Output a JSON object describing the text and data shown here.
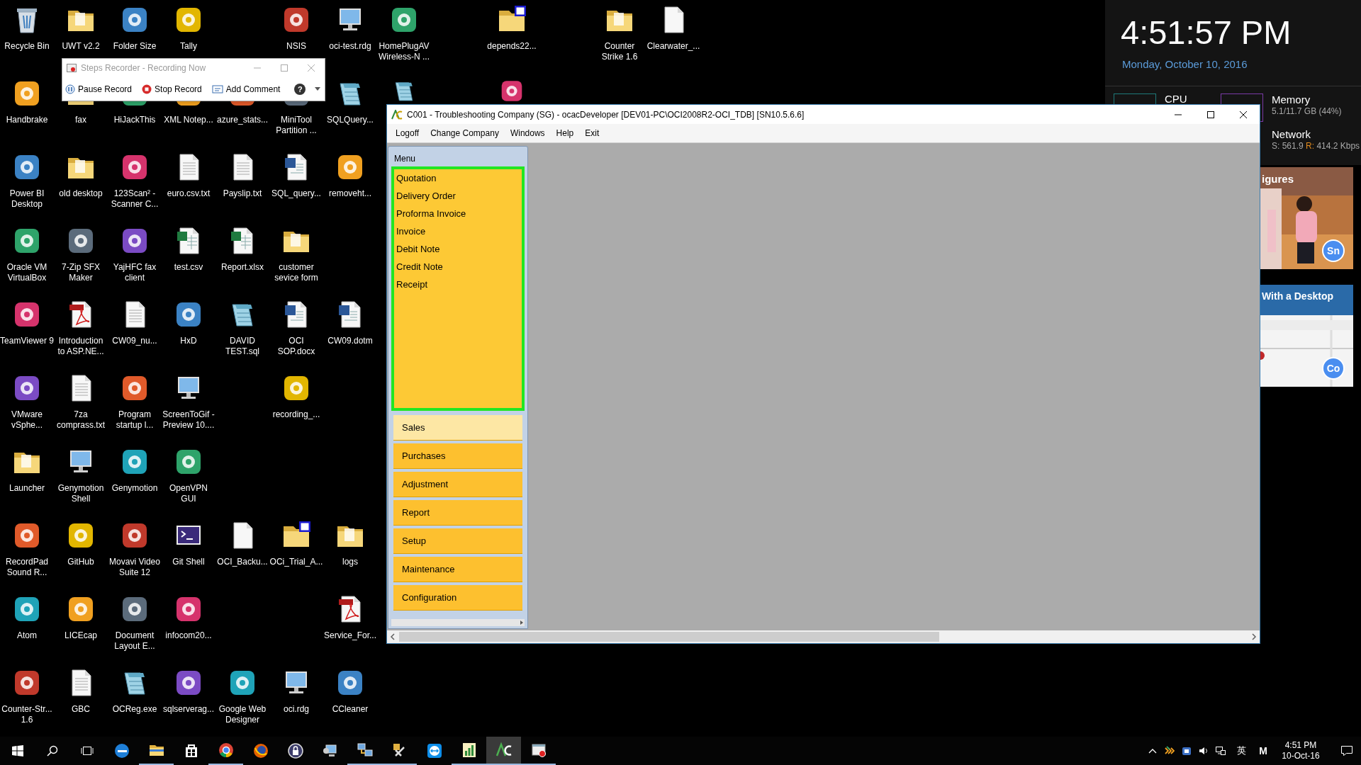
{
  "desktop": {
    "columns": [
      [
        {
          "kind": "recycle",
          "label": "Recycle Bin"
        },
        {
          "kind": "app",
          "label": "Handbrake"
        },
        {
          "kind": "app",
          "label": "Power BI Desktop"
        },
        {
          "kind": "app",
          "label": "Oracle VM VirtualBox"
        },
        {
          "kind": "app",
          "label": "TeamViewer 9"
        },
        {
          "kind": "app",
          "label": "VMware vSphe..."
        },
        {
          "kind": "folder",
          "label": "Launcher"
        },
        {
          "kind": "app",
          "label": "RecordPad Sound R..."
        },
        {
          "kind": "app",
          "label": "Atom"
        },
        {
          "kind": "app",
          "label": "Counter-Str... 1.6"
        }
      ],
      [
        {
          "kind": "folder",
          "label": "UWT v2.2"
        },
        {
          "kind": "folder",
          "label": "fax"
        },
        {
          "kind": "folder",
          "label": "old desktop"
        },
        {
          "kind": "app",
          "label": "7-Zip SFX Maker"
        },
        {
          "kind": "pdf",
          "label": "Introduction to ASP.NE..."
        },
        {
          "kind": "file",
          "label": "7za comprass.txt"
        },
        {
          "kind": "monitor",
          "label": "Genymotion Shell"
        },
        {
          "kind": "app",
          "label": "GitHub"
        },
        {
          "kind": "app",
          "label": "LICEcap"
        },
        {
          "kind": "file",
          "label": "GBC"
        }
      ],
      [
        {
          "kind": "app",
          "label": "Folder Size"
        },
        {
          "kind": "app",
          "label": "HiJackThis"
        },
        {
          "kind": "app",
          "label": "123Scan² - Scanner C..."
        },
        {
          "kind": "app",
          "label": "YajHFC fax client"
        },
        {
          "kind": "file",
          "label": "CW09_nu..."
        },
        {
          "kind": "app",
          "label": "Program startup l..."
        },
        {
          "kind": "app",
          "label": "Genymotion"
        },
        {
          "kind": "app",
          "label": "Movavi Video Suite 12"
        },
        {
          "kind": "app",
          "label": "Document Layout E..."
        },
        {
          "kind": "notepad",
          "label": "OCReg.exe"
        }
      ],
      [
        {
          "kind": "app",
          "label": "Tally"
        },
        {
          "kind": "app",
          "label": "XML Notep..."
        },
        {
          "kind": "file",
          "label": "euro.csv.txt"
        },
        {
          "kind": "excel",
          "label": "test.csv"
        },
        {
          "kind": "app",
          "label": "HxD"
        },
        {
          "kind": "monitor",
          "label": "ScreenToGif - Preview 10...."
        },
        {
          "kind": "app",
          "label": "OpenVPN GUI"
        },
        {
          "kind": "terminal",
          "label": "Git Shell"
        },
        {
          "kind": "app",
          "label": "infocom20..."
        },
        {
          "kind": "app",
          "label": "sqlserverag..."
        }
      ],
      [
        {
          "kind": "blank"
        },
        {
          "kind": "app",
          "label": "azure_stats..."
        },
        {
          "kind": "file",
          "label": "Payslip.txt"
        },
        {
          "kind": "excel",
          "label": "Report.xlsx"
        },
        {
          "kind": "notepad",
          "label": "DAVID TEST.sql"
        },
        {
          "kind": "blank"
        },
        {
          "kind": "blank"
        },
        {
          "kind": "blankfile",
          "label": "OCI_Backu..."
        },
        {
          "kind": "blank"
        },
        {
          "kind": "app",
          "label": "Google Web Designer"
        }
      ],
      [
        {
          "kind": "app",
          "label": "NSIS"
        },
        {
          "kind": "app",
          "label": "MiniTool Partition ..."
        },
        {
          "kind": "word",
          "label": "SQL_query..."
        },
        {
          "kind": "folder",
          "label": "customer sevice form"
        },
        {
          "kind": "word",
          "label": "OCI SOP.docx"
        },
        {
          "kind": "app",
          "label": "recording_..."
        },
        {
          "kind": "blank"
        },
        {
          "kind": "zipfolder",
          "label": "OCi_Trial_A..."
        },
        {
          "kind": "blank"
        },
        {
          "kind": "monitor",
          "label": "oci.rdg"
        }
      ],
      [
        {
          "kind": "monitor",
          "label": "oci-test.rdg"
        },
        {
          "kind": "notepad",
          "label": "SQLQuery..."
        },
        {
          "kind": "app",
          "label": "removeht..."
        },
        {
          "kind": "blank"
        },
        {
          "kind": "word",
          "label": "CW09.dotm"
        },
        {
          "kind": "blank"
        },
        {
          "kind": "blank"
        },
        {
          "kind": "folder",
          "label": "logs"
        },
        {
          "kind": "pdf",
          "label": "Service_For..."
        },
        {
          "kind": "app",
          "label": "CCleaner"
        }
      ],
      [
        {
          "kind": "app",
          "label": "HomePlugAV Wireless-N ..."
        },
        {
          "kind": "notepad"
        }
      ],
      [
        {
          "kind": "blank"
        }
      ],
      [
        {
          "kind": "zipfolder",
          "label": "depends22..."
        },
        {
          "kind": "app"
        }
      ],
      [
        {
          "kind": "blank"
        }
      ],
      [
        {
          "kind": "folder",
          "label": "Counter Strike 1.6"
        }
      ],
      [
        {
          "kind": "blankfile",
          "label": "Clearwater_..."
        }
      ]
    ]
  },
  "steps_recorder": {
    "title": "Steps Recorder - Recording Now",
    "active": false,
    "buttons": [
      {
        "kind": "pause",
        "label": "Pause Record"
      },
      {
        "kind": "stop",
        "label": "Stop Record"
      },
      {
        "kind": "comment",
        "label": "Add Comment"
      }
    ],
    "help": "?"
  },
  "app_window": {
    "title": "C001 - Troubleshooting Company (SG) - ocacDeveloper [DEV01-PC\\OCI2008R2-OCI_TDB] [SN10.5.6.6]",
    "active": true,
    "menu": [
      "Logoff",
      "Change Company",
      "Windows",
      "Help",
      "Exit"
    ],
    "panel": {
      "header": "Menu",
      "items": [
        "Quotation",
        "Delivery Order",
        "Proforma Invoice",
        "Invoice",
        "Debit Note",
        "Credit Note",
        "Receipt"
      ],
      "sections": [
        {
          "label": "Sales",
          "selected": true
        },
        {
          "label": "Purchases",
          "selected": false
        },
        {
          "label": "Adjustment",
          "selected": false
        },
        {
          "label": "Report",
          "selected": false
        },
        {
          "label": "Setup",
          "selected": false
        },
        {
          "label": "Maintenance",
          "selected": false
        },
        {
          "label": "Configuration",
          "selected": false
        }
      ]
    }
  },
  "widget": {
    "time": "4:51:57 PM",
    "date": "Monday, October 10, 2016",
    "cpu": {
      "label": "CPU"
    },
    "memory": {
      "label": "Memory",
      "reading": "5.1/11.7 GB (44%)"
    },
    "network": {
      "label": "Network",
      "sent": "S: 561.9",
      "received_label": "R:",
      "received": "414.2 Kbps"
    }
  },
  "news": [
    {
      "title": "igures",
      "badge": "Sn"
    },
    {
      "title": "With a Desktop",
      "badge": "Co"
    }
  ],
  "taskbar": {
    "apps": [
      {
        "kind": "edge",
        "running": false,
        "selected": false
      },
      {
        "kind": "explorer",
        "running": true,
        "selected": false
      },
      {
        "kind": "store",
        "running": false,
        "selected": false
      },
      {
        "kind": "chrome",
        "running": true,
        "selected": false
      },
      {
        "kind": "firefox",
        "running": false,
        "selected": false
      },
      {
        "kind": "lock",
        "running": false,
        "selected": false
      },
      {
        "kind": "rdg",
        "running": false,
        "selected": false
      },
      {
        "kind": "network",
        "running": true,
        "selected": false
      },
      {
        "kind": "tools",
        "running": true,
        "selected": false
      },
      {
        "kind": "teamviewer",
        "running": false,
        "selected": false
      },
      {
        "kind": "chart",
        "running": true,
        "selected": false
      },
      {
        "kind": "ac",
        "running": true,
        "selected": true
      },
      {
        "kind": "recorder",
        "running": true,
        "selected": false
      }
    ],
    "tray": [
      {
        "kind": "chevron"
      },
      {
        "kind": "colorbars"
      },
      {
        "kind": "shield"
      },
      {
        "kind": "volume"
      },
      {
        "kind": "network"
      }
    ],
    "ime": "英",
    "keyboard": "M",
    "time": "4:51 PM",
    "date": "10-Oct-16"
  }
}
